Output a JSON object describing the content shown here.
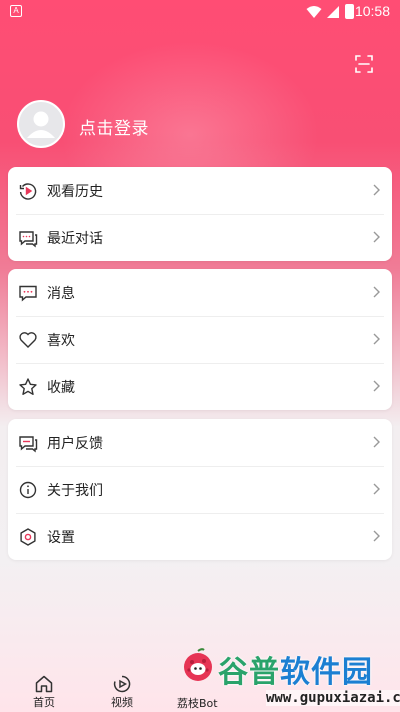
{
  "status_bar": {
    "time": "10:58",
    "app_badge": "A"
  },
  "header": {
    "login_text": "点击登录"
  },
  "menu_groups": [
    {
      "items": [
        {
          "label": "观看历史",
          "icon": "history-icon"
        },
        {
          "label": "最近对话",
          "icon": "chat-icon"
        }
      ]
    },
    {
      "items": [
        {
          "label": "消息",
          "icon": "message-icon"
        },
        {
          "label": "喜欢",
          "icon": "heart-icon"
        },
        {
          "label": "收藏",
          "icon": "star-icon"
        }
      ]
    },
    {
      "items": [
        {
          "label": "用户反馈",
          "icon": "feedback-icon"
        },
        {
          "label": "关于我们",
          "icon": "info-icon"
        },
        {
          "label": "设置",
          "icon": "gear-icon"
        }
      ]
    }
  ],
  "tab_bar": {
    "items": [
      {
        "label": "首页",
        "icon": "home-icon"
      },
      {
        "label": "视频",
        "icon": "video-icon"
      },
      {
        "label": "荔枝Bot",
        "icon": "lychee-bot-icon"
      }
    ]
  },
  "watermark": {
    "title_part1": "谷普",
    "title_part2": "软件园",
    "url": "www.gupuxiazai.com"
  },
  "colors": {
    "accent": "#ff4d74",
    "icon_red": "#e8385a"
  }
}
